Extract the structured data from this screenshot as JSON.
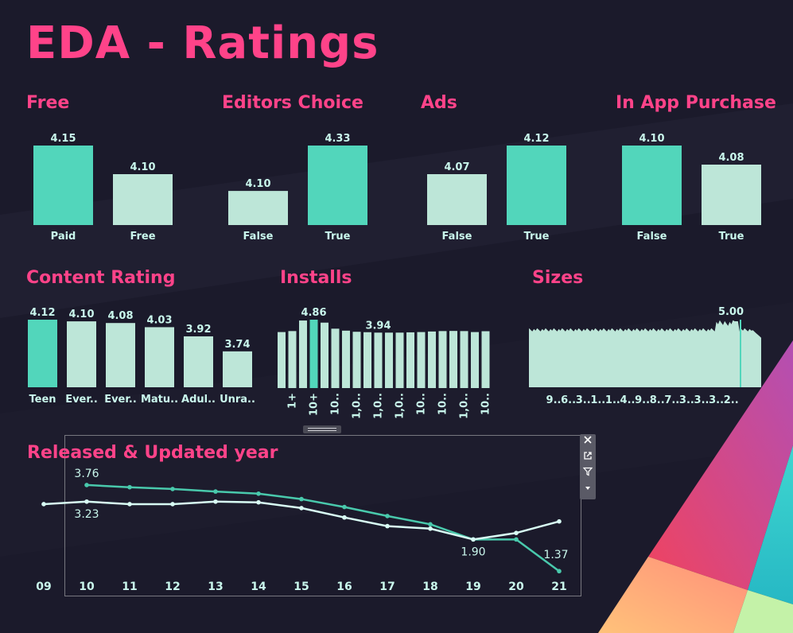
{
  "title": "EDA - Ratings",
  "colors": {
    "background": "#1b1a2b",
    "accent_pink": "#ff4389",
    "bar_highlight": "#52d6bb",
    "bar_light": "#bde6d8",
    "label": "#c9f7ec",
    "line_updated": "#49c9ac",
    "line_released": "#d8fcf4"
  },
  "icons": [
    "close-icon",
    "pop-out-icon",
    "filter-icon",
    "caret-down-icon",
    "drag-handle-icon"
  ],
  "chart_data": [
    {
      "id": "free",
      "type": "bar",
      "title": "Free",
      "categories": [
        "Paid",
        "Free"
      ],
      "values": [
        4.15,
        4.1
      ],
      "labels": [
        "4.15",
        "4.10"
      ],
      "highlight": 0,
      "ylim": [
        4.05,
        4.15
      ]
    },
    {
      "id": "editors",
      "type": "bar",
      "title": "Editors Choice",
      "categories": [
        "False",
        "True"
      ],
      "values": [
        4.1,
        4.33
      ],
      "labels": [
        "4.10",
        "4.33"
      ],
      "highlight": 1,
      "ylim": [
        4.04,
        4.33
      ]
    },
    {
      "id": "ads",
      "type": "bar",
      "title": "Ads",
      "categories": [
        "False",
        "True"
      ],
      "values": [
        4.07,
        4.12
      ],
      "labels": [
        "4.07",
        "4.12"
      ],
      "highlight": 1,
      "ylim": [
        4.02,
        4.12
      ]
    },
    {
      "id": "iap",
      "type": "bar",
      "title": "In App Purchase",
      "categories": [
        "False",
        "True"
      ],
      "values": [
        4.1,
        4.08
      ],
      "labels": [
        "4.10",
        "4.08"
      ],
      "highlight": 0,
      "ylim": [
        4.04,
        4.1
      ]
    },
    {
      "id": "content",
      "type": "bar",
      "title": "Content Rating",
      "categories": [
        "Teen",
        "Ever..",
        "Ever..",
        "Matu..",
        "Adul..",
        "Unra.."
      ],
      "values": [
        4.12,
        4.1,
        4.08,
        4.03,
        3.92,
        3.74
      ],
      "labels": [
        "4.12",
        "4.10",
        "4.08",
        "4.03",
        "3.92",
        "3.74"
      ],
      "highlight": 0,
      "ylim": [
        3.5,
        4.12
      ]
    },
    {
      "id": "installs",
      "type": "bar",
      "title": "Installs",
      "categories": [
        "",
        "1+",
        "",
        "10+",
        "",
        "10..",
        "",
        "1,0..",
        "",
        "1,0..",
        "",
        "1,0..",
        "",
        "10..",
        "",
        "10..",
        "",
        "1,0..",
        "",
        "10.."
      ],
      "values": [
        3.98,
        4.05,
        4.8,
        4.86,
        4.65,
        4.22,
        4.08,
        4.0,
        3.97,
        3.94,
        3.94,
        3.94,
        3.96,
        3.98,
        4.02,
        4.05,
        4.06,
        4.05,
        3.98,
        4.04
      ],
      "labels": [
        "",
        "",
        "",
        "4.86",
        "",
        "",
        "",
        "",
        "",
        "3.94",
        "",
        "",
        "",
        "",
        "",
        "",
        "",
        "",
        "",
        ""
      ],
      "highlight": 3,
      "ylim": [
        0,
        4.86
      ]
    },
    {
      "id": "sizes",
      "type": "area",
      "title": "Sizes",
      "x_labels": [
        "9..",
        "6..",
        "3..",
        "1..",
        "1..",
        "4..",
        "9..",
        "8..",
        "7..",
        "3..",
        "3..",
        "3..",
        "2.."
      ],
      "max_label": "5.00",
      "max_value": 5.0,
      "typical_value": 4.15,
      "ylim": [
        0,
        5.0
      ]
    },
    {
      "id": "years",
      "type": "line",
      "title": "Released & Updated year",
      "x": [
        "09",
        "10",
        "11",
        "12",
        "13",
        "14",
        "15",
        "16",
        "17",
        "18",
        "19",
        "20",
        "21"
      ],
      "series": [
        {
          "values": [
            null,
            3.76,
            3.7,
            3.65,
            3.58,
            3.52,
            3.37,
            3.15,
            2.9,
            2.67,
            2.25,
            2.25,
            1.37
          ]
        },
        {
          "values": [
            3.23,
            3.3,
            3.23,
            3.23,
            3.3,
            3.28,
            3.12,
            2.86,
            2.62,
            2.55,
            2.25,
            2.43,
            2.75
          ]
        }
      ],
      "point_labels": [
        {
          "series": 0,
          "index": 1,
          "text": "3.76"
        },
        {
          "series": 1,
          "index": 1,
          "text": "3.23"
        },
        {
          "series": 1,
          "index": 10,
          "text": "1.90"
        },
        {
          "series": 0,
          "index": 12,
          "text": "1.37"
        }
      ],
      "ylim": [
        1.0,
        4.2
      ]
    }
  ]
}
